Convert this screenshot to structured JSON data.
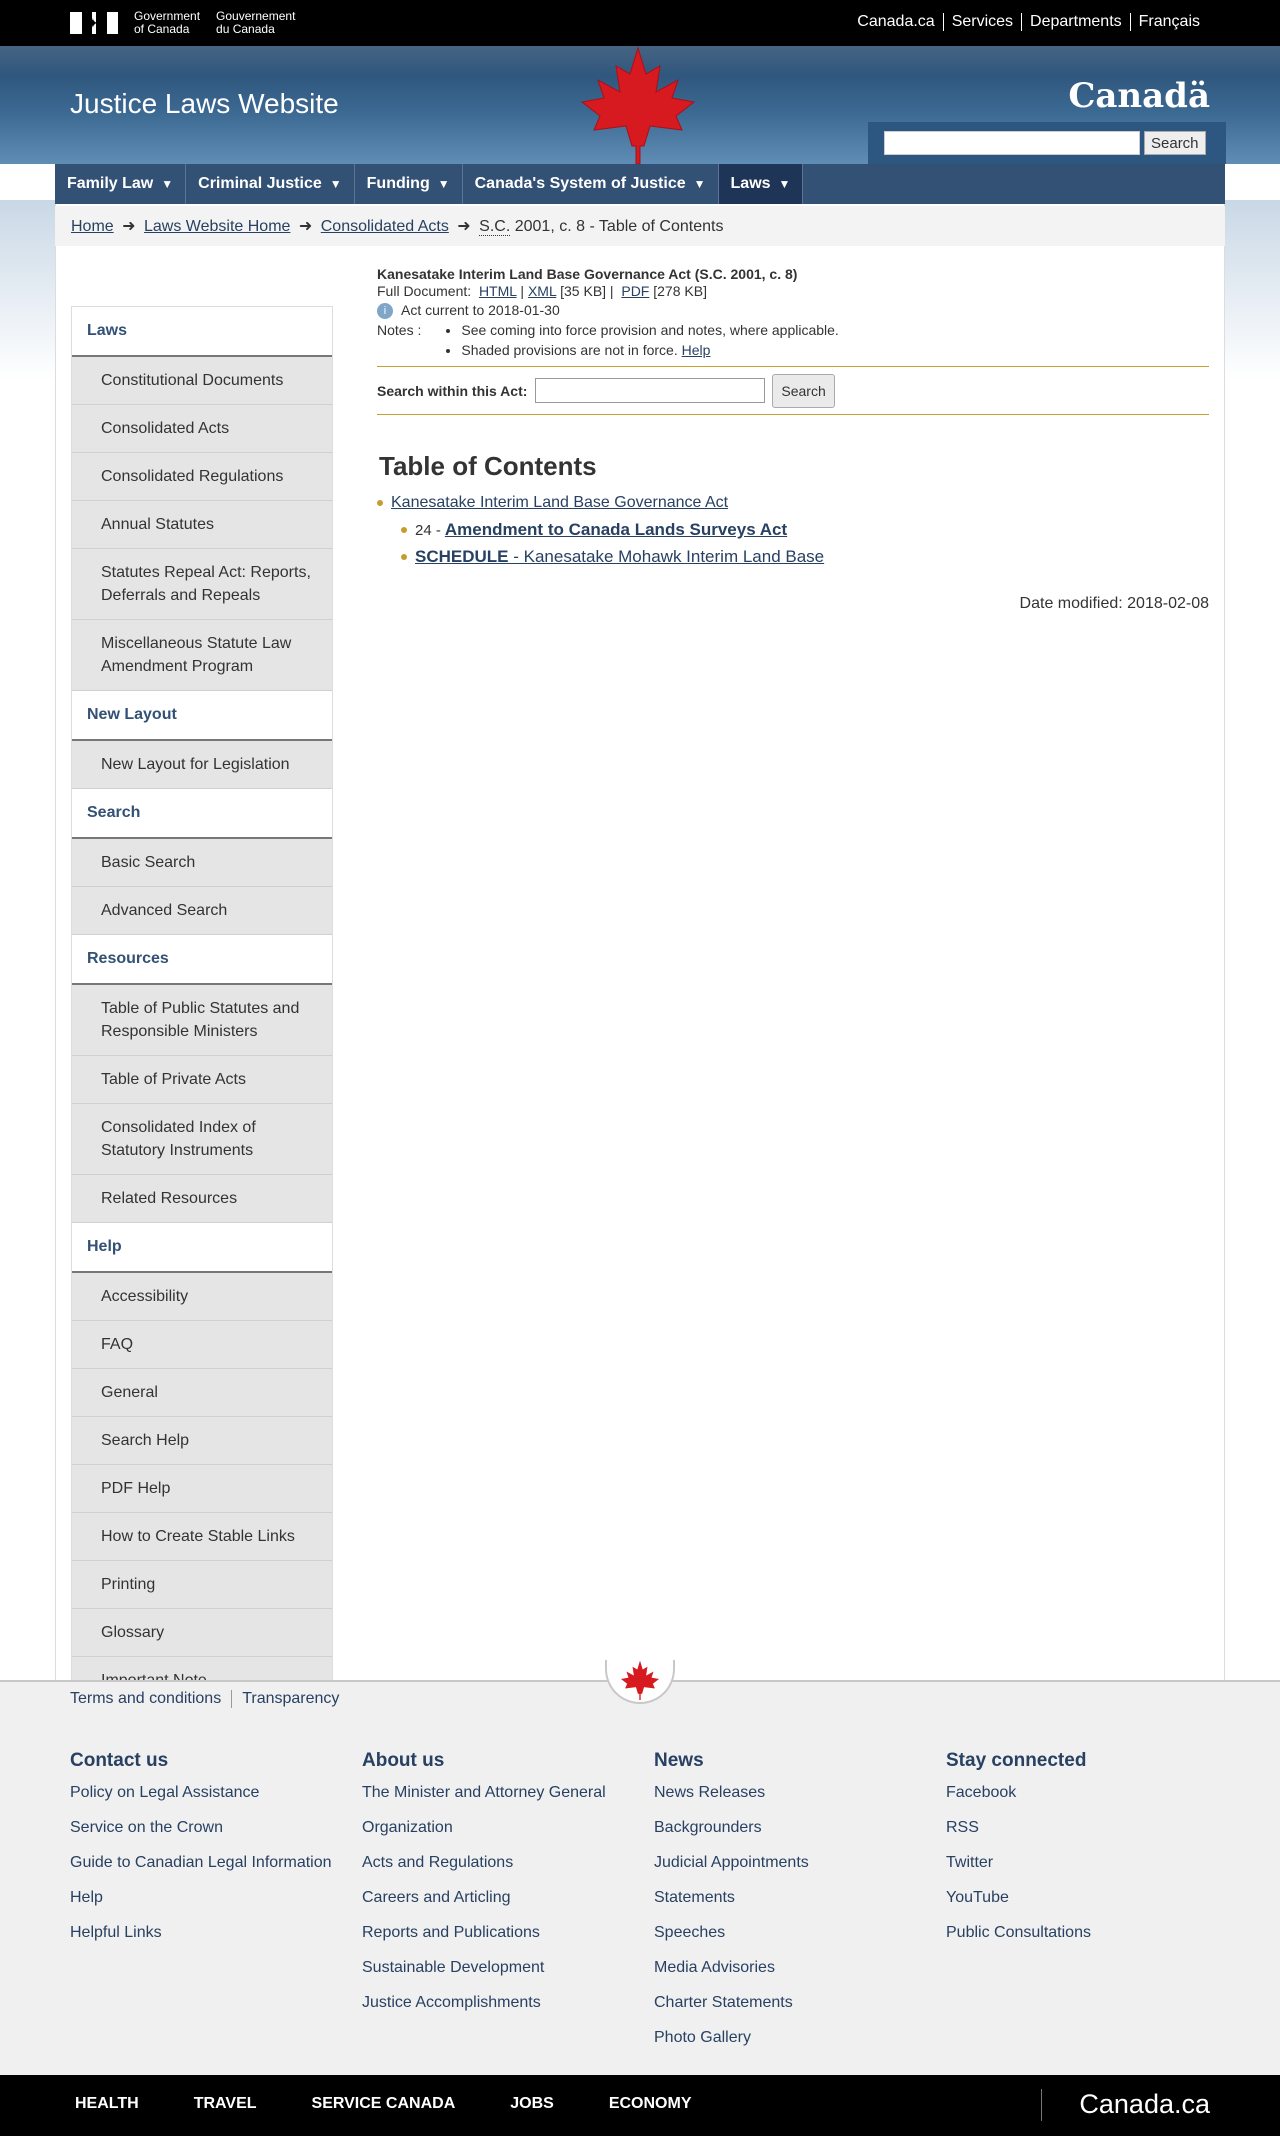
{
  "fip": {
    "gov_en_1": "Government",
    "gov_en_2": "of Canada",
    "gov_fr_1": "Gouvernement",
    "gov_fr_2": "du Canada",
    "links": [
      "Canada.ca",
      "Services",
      "Departments",
      "Français"
    ]
  },
  "banner": {
    "title": "Justice Laws Website",
    "wordmark": "Canadä",
    "search_button": "Search"
  },
  "menu": [
    "Family Law",
    "Criminal Justice",
    "Funding",
    "Canada's System of Justice",
    "Laws"
  ],
  "breadcrumb": {
    "links": [
      "Home",
      "Laws Website Home",
      "Consolidated Acts"
    ],
    "abbr": "S.C.",
    "tail": "2001, c. 8 -  Table of Contents"
  },
  "sidebar": {
    "sections": [
      {
        "title": "Laws",
        "links": [
          "Constitutional Documents",
          "Consolidated Acts",
          "Consolidated Regulations",
          "Annual Statutes",
          "Statutes Repeal Act: Reports, Deferrals and Repeals",
          "Miscellaneous Statute Law Amendment Program"
        ]
      },
      {
        "title": "New Layout",
        "links": [
          "New Layout for Legislation"
        ]
      },
      {
        "title": "Search",
        "links": [
          "Basic Search",
          "Advanced Search"
        ]
      },
      {
        "title": "Resources",
        "links": [
          "Table of Public Statutes and Responsible Ministers",
          "Table of Private Acts",
          "Consolidated Index of Statutory Instruments",
          "Related Resources"
        ]
      },
      {
        "title": "Help",
        "links": [
          "Accessibility",
          "FAQ",
          "General",
          "Search Help",
          "PDF Help",
          "How to Create Stable Links",
          "Printing",
          "Glossary",
          "Important Note"
        ]
      }
    ]
  },
  "act": {
    "title": "Kanesatake Interim Land Base Governance Act (S.C. 2001, c. 8)",
    "full_doc_label": "Full Document:",
    "html": "HTML",
    "xml": "XML",
    "xml_size": "[35 KB] |",
    "pdf": "PDF",
    "pdf_size": "[278 KB]",
    "current": "Act current to 2018-01-30",
    "notes_label": "Notes :",
    "note1": "See coming into force provision and notes, where applicable.",
    "note2": "Shaded provisions are not in force.",
    "note2_link": "Help",
    "search_label": "Search within this Act:",
    "search_button": "Search"
  },
  "toc": {
    "heading": "Table of Contents",
    "root": "Kanesatake Interim Land Base Governance Act",
    "item1_num": "24 -",
    "item1_link": "Amendment to Canada Lands Surveys Act",
    "schedule_bold": "SCHEDULE",
    "schedule_rest": " - Kanesatake Mohawk Interim Land Base"
  },
  "date_modified": "Date modified: 2018-02-08",
  "footer": {
    "toplinks": [
      "Terms and conditions",
      "Transparency"
    ],
    "columns": [
      {
        "title": "Contact us",
        "links": [
          "Policy on Legal Assistance",
          "Service on the Crown",
          "Guide to Canadian Legal Information",
          "Help",
          "Helpful Links"
        ]
      },
      {
        "title": "About us",
        "links": [
          "The Minister and Attorney General",
          "Organization",
          "Acts and Regulations",
          "Careers and Articling",
          "Reports and Publications",
          "Sustainable Development",
          "Justice Accomplishments"
        ]
      },
      {
        "title": "News",
        "links": [
          "News Releases",
          "Backgrounders",
          "Judicial Appointments",
          "Statements",
          "Speeches",
          "Media Advisories",
          "Charter Statements",
          "Photo Gallery"
        ]
      },
      {
        "title": "Stay connected",
        "links": [
          "Facebook",
          "RSS",
          "Twitter",
          "YouTube",
          "Public Consultations"
        ]
      }
    ]
  },
  "bottombar": {
    "items": [
      "HEALTH",
      "TRAVEL",
      "SERVICE CANADA",
      "JOBS",
      "ECONOMY"
    ],
    "brand": "Canada.ca"
  },
  "colors": {
    "nav": "#335075",
    "link": "#284162",
    "accent_gold": "#c69d2d",
    "leaf_red": "#d71920"
  }
}
